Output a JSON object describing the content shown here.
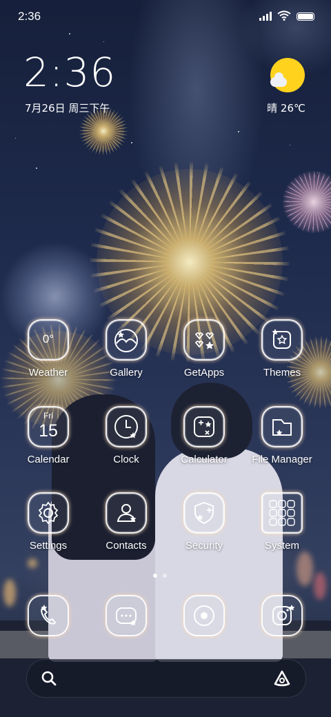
{
  "status_bar": {
    "time": "2:36"
  },
  "clock_widget": {
    "time": "2:36",
    "date": "7月26日 周三下午"
  },
  "weather_widget": {
    "condition_temp": "晴 26℃"
  },
  "apps": [
    {
      "label": "Weather",
      "icon": "weather-icon",
      "text": "0°"
    },
    {
      "label": "Gallery",
      "icon": "gallery-icon"
    },
    {
      "label": "GetApps",
      "icon": "getapps-icon"
    },
    {
      "label": "Themes",
      "icon": "themes-icon"
    },
    {
      "label": "Calendar",
      "icon": "calendar-icon",
      "day": "Fri",
      "date": "15"
    },
    {
      "label": "Clock",
      "icon": "clock-icon"
    },
    {
      "label": "Calculator",
      "icon": "calculator-icon"
    },
    {
      "label": "File Manager",
      "icon": "file-manager-icon"
    },
    {
      "label": "Settings",
      "icon": "settings-icon"
    },
    {
      "label": "Contacts",
      "icon": "contacts-icon"
    },
    {
      "label": "Security",
      "icon": "security-icon"
    },
    {
      "label": "System",
      "icon": "system-folder-icon"
    }
  ],
  "page_indicator": {
    "pages": 2,
    "current": 1
  },
  "dock": [
    {
      "icon": "phone-icon"
    },
    {
      "icon": "messages-icon"
    },
    {
      "icon": "browser-icon"
    },
    {
      "icon": "camera-icon"
    }
  ],
  "search_bar": {
    "left_icon": "search-icon",
    "right_icon": "assistant-icon"
  },
  "colors": {
    "sun": "#ffd21e",
    "sky": "#1f2b4d",
    "tile_border": "#ffffff"
  }
}
